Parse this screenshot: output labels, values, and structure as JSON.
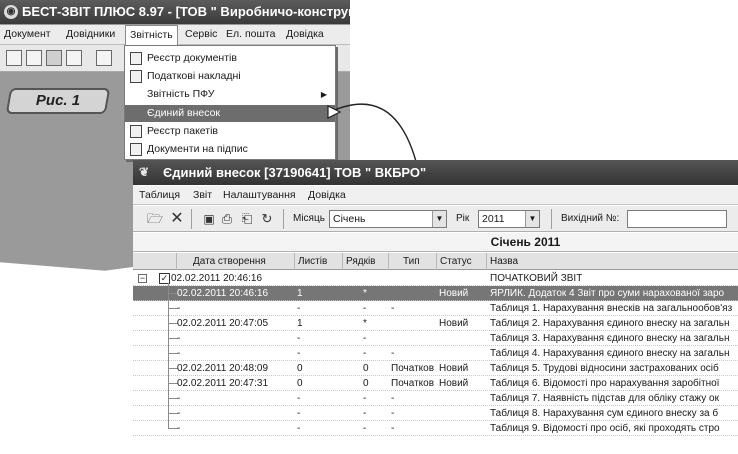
{
  "back_window": {
    "title": "БЕСТ-ЗВІТ ПЛЮС 8.97 - [ТОВ \" Виробничо-конструкт",
    "menu": [
      "Документ",
      "Довідники",
      "Звітність",
      "Сервіс",
      "Ел. пошта",
      "Довідка"
    ],
    "figure_label": "Рис. 1",
    "dropdown": [
      {
        "label": "Реєстр документів",
        "icon": "document-list-icon"
      },
      {
        "label": "Податкові накладні",
        "icon": "invoice-icon"
      },
      {
        "label": "Звітність ПФУ",
        "icon": "",
        "submenu": "▶"
      },
      {
        "label": "Єдиний внесок",
        "icon": ""
      },
      {
        "label": "Реєстр пакетів",
        "icon": "package-icon"
      },
      {
        "label": "Документи на підпис",
        "icon": "signature-doc-icon"
      }
    ]
  },
  "front_window": {
    "title": "Єдиний внесок [37190641] ТОВ \" ВКБРО\"",
    "menu": [
      "Таблиця",
      "Звіт",
      "Налаштування",
      "Довідка"
    ],
    "toolbar": {
      "month_label": "Місяць",
      "month_value": "Січень",
      "year_label": "Рік",
      "year_value": "2011",
      "outgoing_label": "Вихідний №:",
      "outgoing_value": ""
    },
    "period_heading": "Січень 2011",
    "columns": [
      "Дата створення",
      "Листів",
      "Рядків",
      "Тип",
      "Статус",
      "Назва"
    ],
    "rows": [
      {
        "date": "02.02.2011 20:46:16",
        "sheets": "",
        "lines": "",
        "type": "",
        "status": "",
        "name": "ПОЧАТКОВИЙ ЗВІТ",
        "level": 0,
        "selected": false
      },
      {
        "date": "02.02.2011 20:46:16",
        "sheets": "1",
        "lines": "*",
        "type": "",
        "status": "Новий",
        "name": "ЯРЛИК. Додаток 4 Звіт про суми нарахованої заро",
        "level": 1,
        "selected": true
      },
      {
        "date": "-",
        "sheets": "-",
        "lines": "-",
        "type": "-",
        "status": "",
        "name": "Таблиця 1. Нарахування внесків на загальнообов'яз",
        "level": 1,
        "selected": false
      },
      {
        "date": "02.02.2011 20:47:05",
        "sheets": "1",
        "lines": "*",
        "type": "",
        "status": "Новий",
        "name": "Таблиця 2. Нарахування єдиного внеску на загальн",
        "level": 1,
        "selected": false
      },
      {
        "date": "-",
        "sheets": "-",
        "lines": "-",
        "type": "",
        "status": "",
        "name": "Таблиця 3. Нарахування єдиного внеску на загальн",
        "level": 1,
        "selected": false
      },
      {
        "date": "-",
        "sheets": "-",
        "lines": "-",
        "type": "-",
        "status": "",
        "name": "Таблиця 4. Нарахування єдиного внеску на загальн",
        "level": 1,
        "selected": false
      },
      {
        "date": "02.02.2011 20:48:09",
        "sheets": "0",
        "lines": "0",
        "type": "Початков",
        "status": "Новий",
        "name": "Таблиця 5. Трудові відносини застрахованих осіб",
        "level": 1,
        "selected": false
      },
      {
        "date": "02.02.2011 20:47:31",
        "sheets": "0",
        "lines": "0",
        "type": "Початков",
        "status": "Новий",
        "name": "Таблиця 6. Відомості про нарахування заробітної",
        "level": 1,
        "selected": false
      },
      {
        "date": "-",
        "sheets": "-",
        "lines": "-",
        "type": "-",
        "status": "",
        "name": "Таблиця 7. Наявність підстав для обліку стажу ок",
        "level": 1,
        "selected": false
      },
      {
        "date": "-",
        "sheets": "-",
        "lines": "-",
        "type": "-",
        "status": "",
        "name": "Таблиця 8. Нарахування сум єдиного внеску за б",
        "level": 1,
        "selected": false
      },
      {
        "date": "-",
        "sheets": "-",
        "lines": "-",
        "type": "-",
        "status": "",
        "name": "Таблиця 9. Відомості про осіб, які проходять стро",
        "level": 1,
        "selected": false
      }
    ]
  },
  "colors": {
    "titlebar": "#3a3a3a",
    "selection": "#767676",
    "menu_highlight": "#6d6d6d",
    "workspace": "#9a9a9a"
  }
}
